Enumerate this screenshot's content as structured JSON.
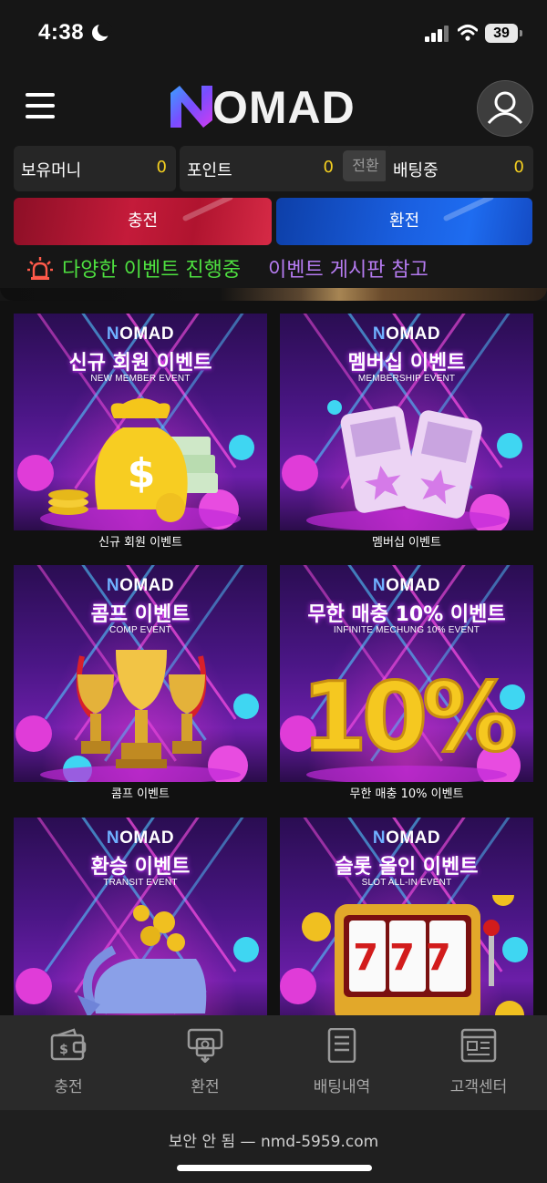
{
  "status_bar": {
    "time": "4:38",
    "battery": "39"
  },
  "header": {
    "logo_text": "OMAD"
  },
  "balance": {
    "money_label": "보유머니",
    "money_value": "0",
    "point_label": "포인트",
    "point_value": "0",
    "convert_label": "전환",
    "betting_label": "배팅중",
    "betting_value": "0"
  },
  "actions": {
    "charge_label": "충전",
    "exchange_label": "환전"
  },
  "notice": {
    "text_green": "다양한 이벤트 진행중",
    "text_purple": "이벤트 게시판 참고"
  },
  "events": [
    {
      "brand": "OMAD",
      "title": "신규 회원 이벤트",
      "subtitle": "NEW MEMBER EVENT",
      "label": "신규 회원 이벤트",
      "art": "money-bag"
    },
    {
      "brand": "OMAD",
      "title": "멤버십 이벤트",
      "subtitle": "MEMBERSHIP EVENT",
      "label": "멤버십 이벤트",
      "art": "tickets"
    },
    {
      "brand": "OMAD",
      "title": "콤프 이벤트",
      "subtitle": "COMP EVENT",
      "label": "콤프 이벤트",
      "art": "trophy"
    },
    {
      "brand": "OMAD",
      "title": "무한 매충 10% 이벤트",
      "subtitle": "INFINITE MECHUNG 10% EVENT",
      "label": "무한 매충 10% 이벤트",
      "art": "ten-percent",
      "art_text": "10%"
    },
    {
      "brand": "OMAD",
      "title": "환승 이벤트",
      "subtitle": "TRANSIT EVENT",
      "label": "",
      "art": "wallet"
    },
    {
      "brand": "OMAD",
      "title": "슬롯 올인 이벤트",
      "subtitle": "SLOT ALL-IN EVENT",
      "label": "",
      "art": "slot-machine",
      "art_text": "777"
    }
  ],
  "bottom_nav": [
    {
      "label": "충전",
      "icon": "wallet-dollar-icon"
    },
    {
      "label": "환전",
      "icon": "atm-withdraw-icon"
    },
    {
      "label": "배팅내역",
      "icon": "document-icon"
    },
    {
      "label": "고객센터",
      "icon": "support-page-icon"
    }
  ],
  "browser": {
    "url_text": "보안 안 됨 — nmd-5959.com"
  }
}
